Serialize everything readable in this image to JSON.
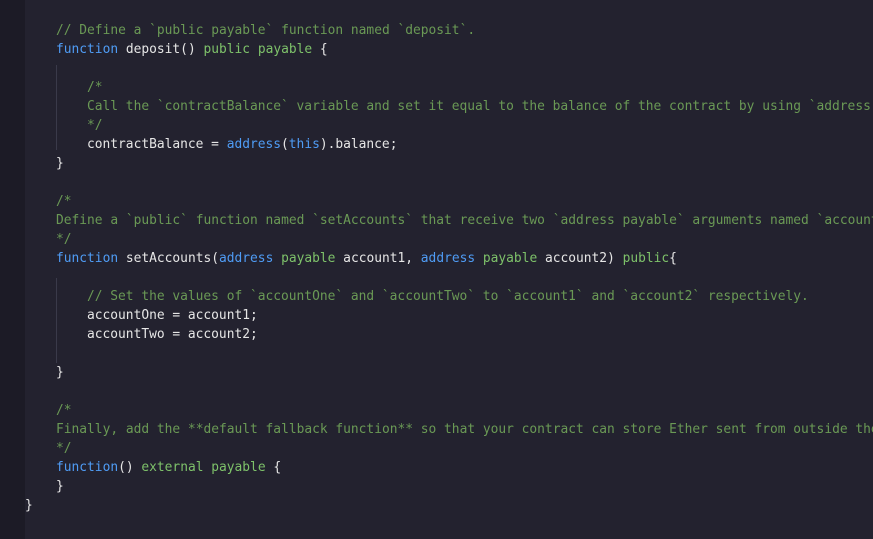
{
  "lines": [
    {
      "indent": 1,
      "tokens": [
        {
          "t": "// Define a `public payable` function named `deposit`.",
          "c": "cmt"
        }
      ]
    },
    {
      "indent": 1,
      "tokens": [
        {
          "t": "function",
          "c": "kw"
        },
        {
          "t": " deposit() ",
          "c": "txt"
        },
        {
          "t": "public",
          "c": "grn"
        },
        {
          "t": " ",
          "c": "txt"
        },
        {
          "t": "payable",
          "c": "grn"
        },
        {
          "t": " {",
          "c": "txt"
        }
      ]
    },
    {
      "indent": 0,
      "tokens": []
    },
    {
      "indent": 2,
      "tokens": [
        {
          "t": "/*",
          "c": "cmt"
        }
      ]
    },
    {
      "indent": 2,
      "tokens": [
        {
          "t": "Call the `contractBalance` variable and set it equal to the balance of the contract by using `address(",
          "c": "cmt"
        }
      ]
    },
    {
      "indent": 2,
      "tokens": [
        {
          "t": "*/",
          "c": "cmt"
        }
      ]
    },
    {
      "indent": 2,
      "tokens": [
        {
          "t": "contractBalance = ",
          "c": "txt"
        },
        {
          "t": "address",
          "c": "kw"
        },
        {
          "t": "(",
          "c": "txt"
        },
        {
          "t": "this",
          "c": "kw"
        },
        {
          "t": ").balance;",
          "c": "txt"
        }
      ]
    },
    {
      "indent": 1,
      "tokens": [
        {
          "t": "}",
          "c": "txt"
        }
      ]
    },
    {
      "indent": 0,
      "tokens": []
    },
    {
      "indent": 1,
      "tokens": [
        {
          "t": "/*",
          "c": "cmt"
        }
      ]
    },
    {
      "indent": 1,
      "tokens": [
        {
          "t": "Define a `public` function named `setAccounts` that receive two `address payable` arguments named `account",
          "c": "cmt"
        }
      ]
    },
    {
      "indent": 1,
      "tokens": [
        {
          "t": "*/",
          "c": "cmt"
        }
      ]
    },
    {
      "indent": 1,
      "tokens": [
        {
          "t": "function",
          "c": "kw"
        },
        {
          "t": " setAccounts(",
          "c": "txt"
        },
        {
          "t": "address",
          "c": "kw"
        },
        {
          "t": " ",
          "c": "txt"
        },
        {
          "t": "payable",
          "c": "grn"
        },
        {
          "t": " account1, ",
          "c": "txt"
        },
        {
          "t": "address",
          "c": "kw"
        },
        {
          "t": " ",
          "c": "txt"
        },
        {
          "t": "payable",
          "c": "grn"
        },
        {
          "t": " account2) ",
          "c": "txt"
        },
        {
          "t": "public",
          "c": "grn"
        },
        {
          "t": "{",
          "c": "txt"
        }
      ]
    },
    {
      "indent": 0,
      "tokens": []
    },
    {
      "indent": 2,
      "tokens": [
        {
          "t": "// Set the values of `accountOne` and `accountTwo` to `account1` and `account2` respectively.",
          "c": "cmt"
        }
      ]
    },
    {
      "indent": 2,
      "tokens": [
        {
          "t": "accountOne = account1;",
          "c": "txt"
        }
      ]
    },
    {
      "indent": 2,
      "tokens": [
        {
          "t": "accountTwo = account2;",
          "c": "txt"
        }
      ]
    },
    {
      "indent": 0,
      "tokens": []
    },
    {
      "indent": 1,
      "tokens": [
        {
          "t": "}",
          "c": "txt"
        }
      ]
    },
    {
      "indent": 0,
      "tokens": []
    },
    {
      "indent": 1,
      "tokens": [
        {
          "t": "/*",
          "c": "cmt"
        }
      ]
    },
    {
      "indent": 1,
      "tokens": [
        {
          "t": "Finally, add the **default fallback function** so that your contract can store Ether sent from outside the",
          "c": "cmt"
        }
      ]
    },
    {
      "indent": 1,
      "tokens": [
        {
          "t": "*/",
          "c": "cmt"
        }
      ]
    },
    {
      "indent": 1,
      "tokens": [
        {
          "t": "function",
          "c": "kw"
        },
        {
          "t": "() ",
          "c": "txt"
        },
        {
          "t": "external",
          "c": "grn"
        },
        {
          "t": " ",
          "c": "txt"
        },
        {
          "t": "payable",
          "c": "grn"
        },
        {
          "t": " {",
          "c": "txt"
        }
      ]
    },
    {
      "indent": 1,
      "tokens": [
        {
          "t": "}",
          "c": "txt"
        }
      ]
    },
    {
      "indent": 0,
      "tokens": [
        {
          "t": "}",
          "c": "txt"
        }
      ]
    }
  ]
}
